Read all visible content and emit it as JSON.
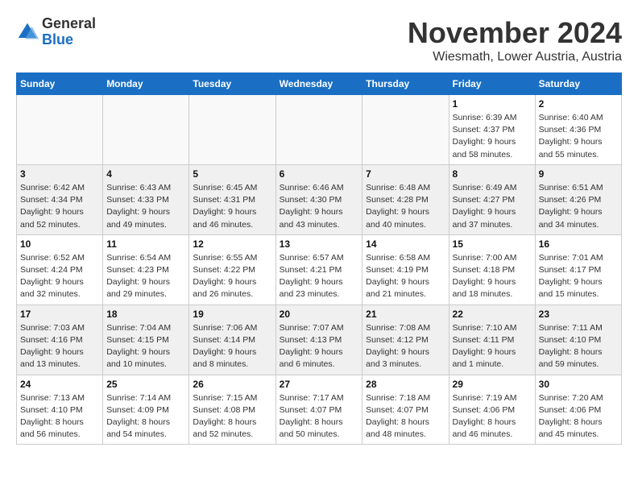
{
  "logo": {
    "line1": "General",
    "line2": "Blue"
  },
  "title": "November 2024",
  "subtitle": "Wiesmath, Lower Austria, Austria",
  "days_of_week": [
    "Sunday",
    "Monday",
    "Tuesday",
    "Wednesday",
    "Thursday",
    "Friday",
    "Saturday"
  ],
  "weeks": [
    [
      {
        "day": "",
        "info": ""
      },
      {
        "day": "",
        "info": ""
      },
      {
        "day": "",
        "info": ""
      },
      {
        "day": "",
        "info": ""
      },
      {
        "day": "",
        "info": ""
      },
      {
        "day": "1",
        "info": "Sunrise: 6:39 AM\nSunset: 4:37 PM\nDaylight: 9 hours and 58 minutes."
      },
      {
        "day": "2",
        "info": "Sunrise: 6:40 AM\nSunset: 4:36 PM\nDaylight: 9 hours and 55 minutes."
      }
    ],
    [
      {
        "day": "3",
        "info": "Sunrise: 6:42 AM\nSunset: 4:34 PM\nDaylight: 9 hours and 52 minutes."
      },
      {
        "day": "4",
        "info": "Sunrise: 6:43 AM\nSunset: 4:33 PM\nDaylight: 9 hours and 49 minutes."
      },
      {
        "day": "5",
        "info": "Sunrise: 6:45 AM\nSunset: 4:31 PM\nDaylight: 9 hours and 46 minutes."
      },
      {
        "day": "6",
        "info": "Sunrise: 6:46 AM\nSunset: 4:30 PM\nDaylight: 9 hours and 43 minutes."
      },
      {
        "day": "7",
        "info": "Sunrise: 6:48 AM\nSunset: 4:28 PM\nDaylight: 9 hours and 40 minutes."
      },
      {
        "day": "8",
        "info": "Sunrise: 6:49 AM\nSunset: 4:27 PM\nDaylight: 9 hours and 37 minutes."
      },
      {
        "day": "9",
        "info": "Sunrise: 6:51 AM\nSunset: 4:26 PM\nDaylight: 9 hours and 34 minutes."
      }
    ],
    [
      {
        "day": "10",
        "info": "Sunrise: 6:52 AM\nSunset: 4:24 PM\nDaylight: 9 hours and 32 minutes."
      },
      {
        "day": "11",
        "info": "Sunrise: 6:54 AM\nSunset: 4:23 PM\nDaylight: 9 hours and 29 minutes."
      },
      {
        "day": "12",
        "info": "Sunrise: 6:55 AM\nSunset: 4:22 PM\nDaylight: 9 hours and 26 minutes."
      },
      {
        "day": "13",
        "info": "Sunrise: 6:57 AM\nSunset: 4:21 PM\nDaylight: 9 hours and 23 minutes."
      },
      {
        "day": "14",
        "info": "Sunrise: 6:58 AM\nSunset: 4:19 PM\nDaylight: 9 hours and 21 minutes."
      },
      {
        "day": "15",
        "info": "Sunrise: 7:00 AM\nSunset: 4:18 PM\nDaylight: 9 hours and 18 minutes."
      },
      {
        "day": "16",
        "info": "Sunrise: 7:01 AM\nSunset: 4:17 PM\nDaylight: 9 hours and 15 minutes."
      }
    ],
    [
      {
        "day": "17",
        "info": "Sunrise: 7:03 AM\nSunset: 4:16 PM\nDaylight: 9 hours and 13 minutes."
      },
      {
        "day": "18",
        "info": "Sunrise: 7:04 AM\nSunset: 4:15 PM\nDaylight: 9 hours and 10 minutes."
      },
      {
        "day": "19",
        "info": "Sunrise: 7:06 AM\nSunset: 4:14 PM\nDaylight: 9 hours and 8 minutes."
      },
      {
        "day": "20",
        "info": "Sunrise: 7:07 AM\nSunset: 4:13 PM\nDaylight: 9 hours and 6 minutes."
      },
      {
        "day": "21",
        "info": "Sunrise: 7:08 AM\nSunset: 4:12 PM\nDaylight: 9 hours and 3 minutes."
      },
      {
        "day": "22",
        "info": "Sunrise: 7:10 AM\nSunset: 4:11 PM\nDaylight: 9 hours and 1 minute."
      },
      {
        "day": "23",
        "info": "Sunrise: 7:11 AM\nSunset: 4:10 PM\nDaylight: 8 hours and 59 minutes."
      }
    ],
    [
      {
        "day": "24",
        "info": "Sunrise: 7:13 AM\nSunset: 4:10 PM\nDaylight: 8 hours and 56 minutes."
      },
      {
        "day": "25",
        "info": "Sunrise: 7:14 AM\nSunset: 4:09 PM\nDaylight: 8 hours and 54 minutes."
      },
      {
        "day": "26",
        "info": "Sunrise: 7:15 AM\nSunset: 4:08 PM\nDaylight: 8 hours and 52 minutes."
      },
      {
        "day": "27",
        "info": "Sunrise: 7:17 AM\nSunset: 4:07 PM\nDaylight: 8 hours and 50 minutes."
      },
      {
        "day": "28",
        "info": "Sunrise: 7:18 AM\nSunset: 4:07 PM\nDaylight: 8 hours and 48 minutes."
      },
      {
        "day": "29",
        "info": "Sunrise: 7:19 AM\nSunset: 4:06 PM\nDaylight: 8 hours and 46 minutes."
      },
      {
        "day": "30",
        "info": "Sunrise: 7:20 AM\nSunset: 4:06 PM\nDaylight: 8 hours and 45 minutes."
      }
    ]
  ]
}
